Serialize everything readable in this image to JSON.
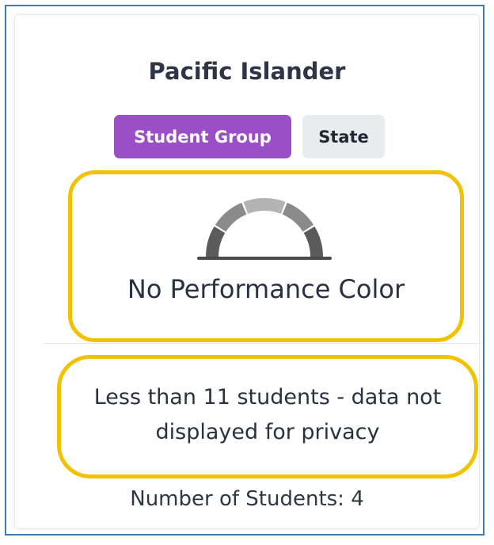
{
  "card": {
    "title": "Pacific Islander",
    "tabs": [
      {
        "label": "Student Group",
        "active": true
      },
      {
        "label": "State",
        "active": false
      }
    ],
    "performance": {
      "gauge_icon": "gauge-icon",
      "label": "No Performance Color"
    },
    "privacy_message": "Less than 11 students - data not displayed for privacy",
    "student_count": "Number of Students: 4"
  },
  "colors": {
    "accent_purple": "#9b4fc6",
    "highlight_yellow": "#f2c200",
    "frame_blue": "#3c7ab8",
    "text_dark": "#2d3546"
  }
}
